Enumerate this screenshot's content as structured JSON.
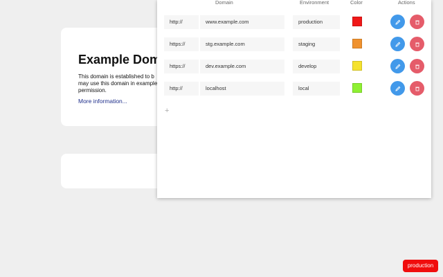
{
  "background_page": {
    "title": "Example Domain",
    "text": "This domain is established to b may use this domain in example permission.",
    "link": "More information..."
  },
  "table": {
    "headers": {
      "domain": "Domain",
      "environment": "Environment",
      "color": "Color",
      "actions": "Actions"
    },
    "rows": [
      {
        "protocol": "http://",
        "domain": "www.example.com",
        "environment": "production",
        "color": "#f01818"
      },
      {
        "protocol": "https://",
        "domain": "stg.example.com",
        "environment": "staging",
        "color": "#f0922e"
      },
      {
        "protocol": "https://",
        "domain": "dev.example.com",
        "environment": "develop",
        "color": "#f5e22d"
      },
      {
        "protocol": "http://",
        "domain": "localhost",
        "environment": "local",
        "color": "#8ef032"
      }
    ],
    "add_label": "+"
  },
  "icons": {
    "edit": "pencil-icon",
    "delete": "trash-icon"
  },
  "env_badge": {
    "label": "production",
    "color": "#f00d0d"
  }
}
